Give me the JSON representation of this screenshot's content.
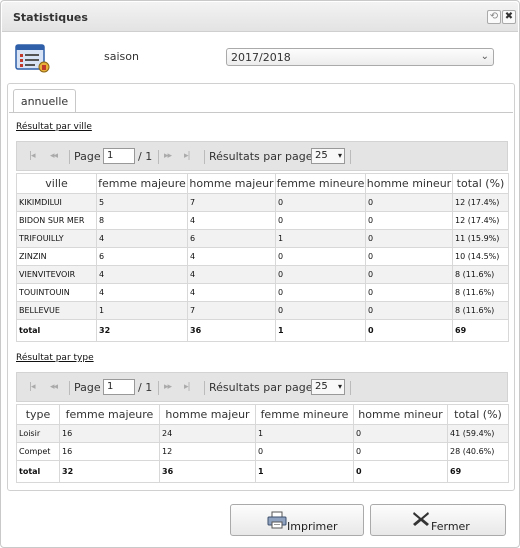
{
  "window": {
    "title": "Statistiques",
    "restore_glyph": "⟲",
    "close_glyph": "✖"
  },
  "season": {
    "label": "saison",
    "value": "2017/2018",
    "arrow": "⌄"
  },
  "tab": {
    "label": "annuelle"
  },
  "by_city": {
    "link": "Résultat par ville",
    "pager": {
      "first": "|◂",
      "prev": "◂◂",
      "page_label": "Page",
      "page_value": "1",
      "of": "/ 1",
      "next": "▸▸",
      "last": "▸|",
      "per_page_label": "Résultats par page:",
      "per_page_value": "25",
      "per_page_arrow": "▾"
    },
    "headers": [
      "ville",
      "femme majeure",
      "homme majeur",
      "femme mineure",
      "homme mineur",
      "total (%)"
    ],
    "rows": [
      [
        "KIKIMDILUI",
        "5",
        "7",
        "0",
        "0",
        "12 (17.4%)"
      ],
      [
        "BIDON SUR MER",
        "8",
        "4",
        "0",
        "0",
        "12 (17.4%)"
      ],
      [
        "TRIFOUILLY",
        "4",
        "6",
        "1",
        "0",
        "11 (15.9%)"
      ],
      [
        "ZINZIN",
        "6",
        "4",
        "0",
        "0",
        "10 (14.5%)"
      ],
      [
        "VIENVITEVOIR",
        "4",
        "4",
        "0",
        "0",
        "8 (11.6%)"
      ],
      [
        "TOUINTOUIN",
        "4",
        "4",
        "0",
        "0",
        "8 (11.6%)"
      ],
      [
        "BELLEVUE",
        "1",
        "7",
        "0",
        "0",
        "8 (11.6%)"
      ]
    ],
    "total": [
      "total",
      "32",
      "36",
      "1",
      "0",
      "69"
    ]
  },
  "by_type": {
    "link": "Résultat par type",
    "pager": {
      "first": "|◂",
      "prev": "◂◂",
      "page_label": "Page",
      "page_value": "1",
      "of": "/ 1",
      "next": "▸▸",
      "last": "▸|",
      "per_page_label": "Résultats par page:",
      "per_page_value": "25",
      "per_page_arrow": "▾"
    },
    "headers": [
      "type",
      "femme majeure",
      "homme majeur",
      "femme mineure",
      "homme mineur",
      "total (%)"
    ],
    "rows": [
      [
        "Loisir",
        "16",
        "24",
        "1",
        "0",
        "41 (59.4%)"
      ],
      [
        "Compet",
        "16",
        "12",
        "0",
        "0",
        "28 (40.6%)"
      ]
    ],
    "total": [
      "total",
      "32",
      "36",
      "1",
      "0",
      "69"
    ]
  },
  "buttons": {
    "print": "Imprimer",
    "close": "Fermer"
  },
  "icons": [
    "statistics-icon",
    "printer-icon",
    "close-x-icon",
    "restore-icon",
    "close-icon"
  ]
}
